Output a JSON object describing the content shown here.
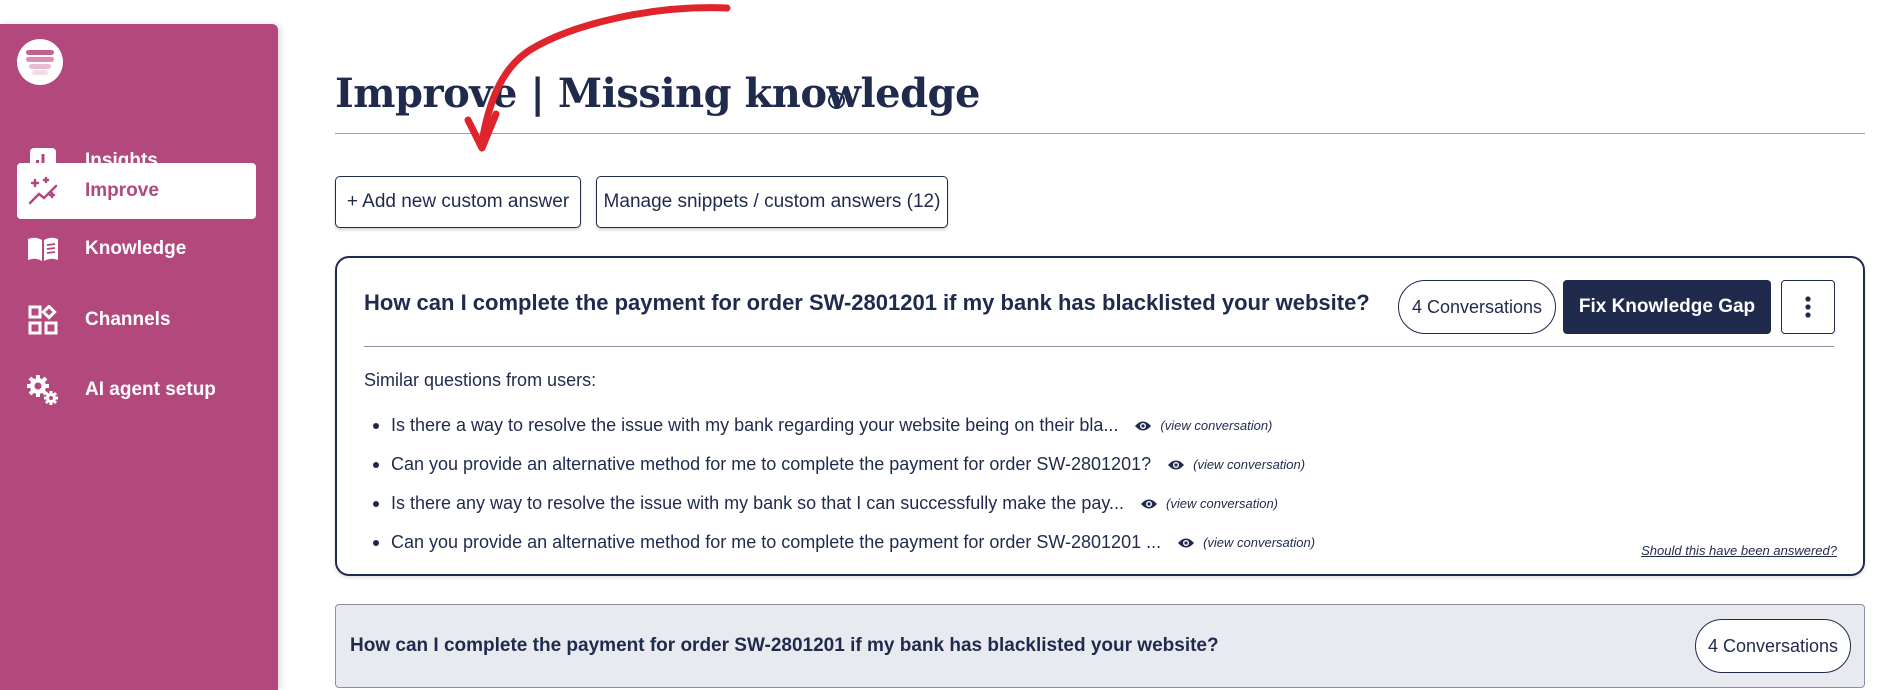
{
  "sidebar": {
    "items": [
      {
        "label": "Insights",
        "icon": "bar-chart-icon"
      },
      {
        "label": "Improve",
        "icon": "sparkles-icon",
        "active": true
      },
      {
        "label": "Knowledge",
        "icon": "book-icon"
      },
      {
        "label": "Channels",
        "icon": "grid-icon"
      },
      {
        "label": "AI agent setup",
        "icon": "gear-icon"
      }
    ]
  },
  "page": {
    "title": "Improve | Missing knowledge",
    "help_icon": "?"
  },
  "toolbar": {
    "add_label": "+ Add new custom answer",
    "manage_label": "Manage snippets / custom answers (12)"
  },
  "cards": [
    {
      "question": "How can I complete the payment for order SW-2801201 if my bank has blacklisted your website?",
      "conversations": "4 Conversations",
      "fix_label": "Fix Knowledge Gap",
      "similar_heading": "Similar questions from users:",
      "similar": [
        "Is there a way to resolve the issue with my bank regarding your website being on their bla...",
        "Can you provide an alternative method for me to complete the payment for order SW-2801201?",
        "Is there any way to resolve the issue with my bank so that I can successfully make the pay...",
        "Can you provide an alternative method for me to complete the payment for order SW-2801201 ..."
      ],
      "view_label": "(view conversation)",
      "should_label": "Should this have been answered?"
    },
    {
      "question": "How can I complete the payment for order SW-2801201 if my bank has blacklisted your website?",
      "conversations": "4 Conversations"
    }
  ],
  "colors": {
    "sidebar": "#b3487d",
    "navy": "#1f2a4d",
    "annotation_arrow": "#e0242c",
    "collapsed_card": "#e9eaf0"
  }
}
